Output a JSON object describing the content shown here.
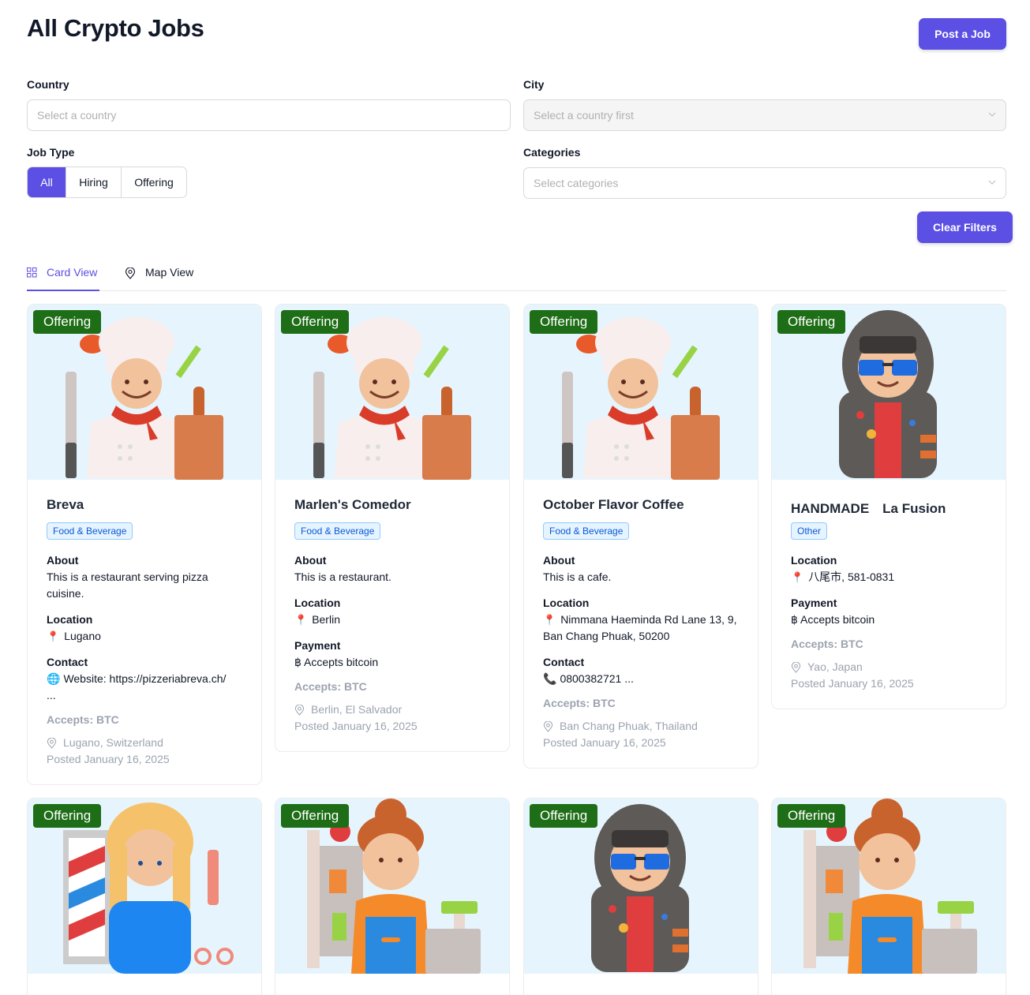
{
  "header": {
    "title": "All Crypto Jobs",
    "post_job_label": "Post a Job"
  },
  "filters": {
    "country_label": "Country",
    "country_placeholder": "Select a country",
    "city_label": "City",
    "city_placeholder": "Select a country first",
    "job_type_label": "Job Type",
    "job_types": [
      "All",
      "Hiring",
      "Offering"
    ],
    "job_type_selected": "All",
    "categories_label": "Categories",
    "categories_placeholder": "Select categories",
    "clear_label": "Clear Filters"
  },
  "tabs": {
    "card_view": "Card View",
    "map_view": "Map View",
    "active": "Card View"
  },
  "colors": {
    "accent": "#5b4fe4",
    "offering_badge": "#1e6d17",
    "image_bg": "#e6f5fd"
  },
  "cards": [
    {
      "badge": "Offering",
      "image": "chef-illustration",
      "title": "Breva",
      "category": "Food & Beverage",
      "about_label": "About",
      "about": "This is a restaurant serving pizza cuisine.",
      "location_label": "Location",
      "location": "Lugano",
      "contact_label": "Contact",
      "contact": "Website: https://pizzeriabreva.ch/",
      "contact_more": "...",
      "accepts": "Accepts: BTC",
      "place": "Lugano, Switzerland",
      "posted": "Posted January 16, 2025"
    },
    {
      "badge": "Offering",
      "image": "chef-illustration",
      "title": "Marlen's Comedor",
      "category": "Food & Beverage",
      "about_label": "About",
      "about": "This is a restaurant.",
      "location_label": "Location",
      "location": "Berlin",
      "payment_label": "Payment",
      "payment": "฿ Accepts bitcoin",
      "accepts": "Accepts: BTC",
      "place": "Berlin, El Salvador",
      "posted": "Posted January 16, 2025"
    },
    {
      "badge": "Offering",
      "image": "chef-illustration",
      "title": "October Flavor Coffee",
      "category": "Food & Beverage",
      "about_label": "About",
      "about": "This is a cafe.",
      "location_label": "Location",
      "location": "Nimmana Haeminda Rd Lane 13, 9, Ban Chang Phuak, 50200",
      "contact_label": "Contact",
      "contact": "0800382721 ...",
      "accepts": "Accepts: BTC",
      "place": "Ban Chang Phuak, Thailand",
      "posted": "Posted January 16, 2025"
    },
    {
      "badge": "Offering",
      "image": "hooded-person-illustration",
      "title": "HANDMADE　La Fusion",
      "category": "Other",
      "location_label": "Location",
      "location": "八尾市, 581-0831",
      "payment_label": "Payment",
      "payment": "฿ Accepts bitcoin",
      "accepts": "Accepts: BTC",
      "place": "Yao, Japan",
      "posted": "Posted January 16, 2025"
    },
    {
      "badge": "Offering",
      "image": "barber-illustration"
    },
    {
      "badge": "Offering",
      "image": "shopkeeper-illustration"
    },
    {
      "badge": "Offering",
      "image": "hooded-person-illustration"
    },
    {
      "badge": "Offering",
      "image": "shopkeeper-illustration"
    }
  ]
}
